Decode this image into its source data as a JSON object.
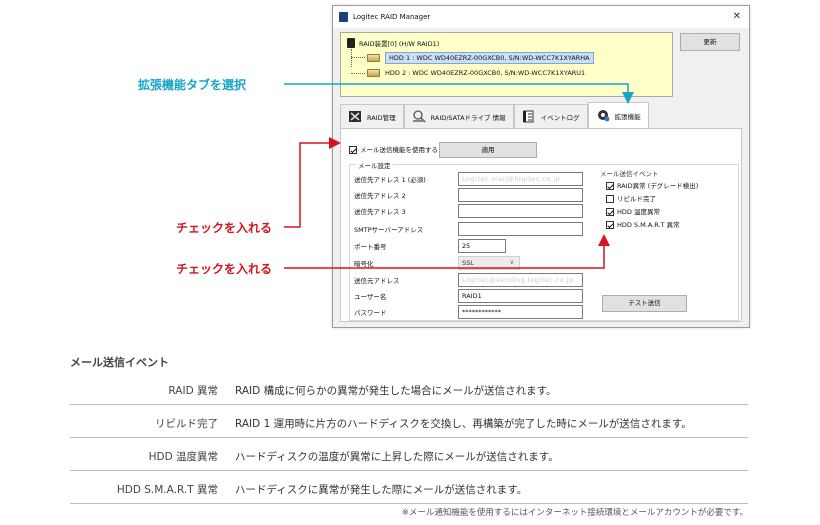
{
  "window": {
    "title": "Logitec RAID Manager",
    "close_glyph": "✕",
    "tree": {
      "root_label": "RAID装置[0]  (H/W RAID1)",
      "hdd1": "HDD 1 :  WDC WD40EZRZ-00GXCB0, S/N:WD-WCC7K1XYARHA",
      "hdd2": "HDD 2 :  WDC WD40EZRZ-00GXCB0, S/N:WD-WCC7K1XYARU1"
    },
    "update_button": "更新",
    "tabs": [
      {
        "label": "RAID管理",
        "icon": "raid-tools-icon"
      },
      {
        "label": "RAID/SATAドライブ 情報",
        "icon": "magnifier-icon"
      },
      {
        "label": "イベントログ",
        "icon": "log-icon"
      },
      {
        "label": "拡張機能",
        "icon": "gear-icon"
      }
    ],
    "enable_mail_label": "メール送信機能を使用する",
    "apply_button": "適用",
    "mail_settings": {
      "title": "メール設定",
      "dest1_label": "送信先アドレス 1 (必須)",
      "dest1_value": "Logitec.mail@logitec.co.jp",
      "dest2_label": "送信先アドレス 2",
      "dest3_label": "送信先アドレス 3",
      "smtp_label": "SMTPサーバーアドレス",
      "port_label": "ポート番号",
      "port_value": "25",
      "encrypt_label": "暗号化",
      "encrypt_value": "SSL",
      "sender_label": "送信元アドレス",
      "sender_value": "Logitec@sending.logitec.co.jp",
      "user_label": "ユーザー名",
      "user_value": "RAID1",
      "password_label": "パスワード",
      "password_value": "************",
      "test_button": "テスト送信"
    },
    "events": {
      "title": "メール送信イベント",
      "items": [
        {
          "label": "RAID異常 (デグレード検出)",
          "checked": true
        },
        {
          "label": "リビルド完了",
          "checked": false
        },
        {
          "label": "HDD 温度異常",
          "checked": true
        },
        {
          "label": "HDD S.M.A.R.T 異常",
          "checked": true
        }
      ]
    }
  },
  "callouts": {
    "tab": "拡張機能タブを選択",
    "check1": "チェックを入れる",
    "check2": "チェックを入れる",
    "blue": "#17a5c9",
    "red": "#d4151f"
  },
  "table": {
    "title": "メール送信イベント",
    "rows": [
      {
        "name": "RAID 異常",
        "desc": "RAID 構成に何らかの異常が発生した場合にメールが送信されます。"
      },
      {
        "name": "リビルド完了",
        "desc": "RAID 1 運用時に片方のハードディスクを交換し、再構築が完了した時にメールが送信されます。"
      },
      {
        "name": "HDD 温度異常",
        "desc": "ハードディスクの温度が異常に上昇した際にメールが送信されます。"
      },
      {
        "name": "HDD S.M.A.R.T 異常",
        "desc": "ハードディスクに異常が発生した際にメールが送信されます。"
      }
    ],
    "note": "※メール通知機能を使用するにはインターネット接続環境とメールアカウントが必要です。"
  }
}
